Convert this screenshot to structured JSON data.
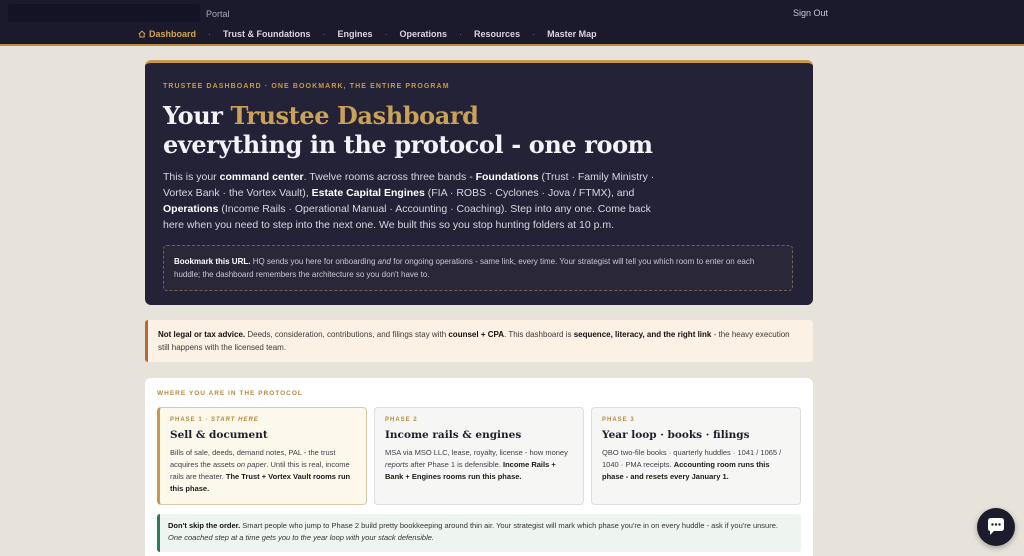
{
  "header": {
    "portal_label": "Portal",
    "sign_out": "Sign Out",
    "nav": [
      {
        "label": "Dashboard",
        "active": true
      },
      {
        "label": "Trust & Foundations"
      },
      {
        "label": "Engines"
      },
      {
        "label": "Operations"
      },
      {
        "label": "Resources"
      },
      {
        "label": "Master Map"
      }
    ],
    "separator": "·"
  },
  "hero": {
    "eyebrow": "TRUSTEE DASHBOARD · ONE BOOKMARK, THE ENTIRE PROGRAM",
    "title_pre": "Your ",
    "title_gold": "Trustee Dashboard",
    "title_line2": "everything in the protocol - one room",
    "lead": [
      "This is your ",
      "command center",
      ". Twelve rooms across three bands - ",
      "Foundations",
      " (Trust · Family Ministry · Vortex Bank · the Vortex Vault), ",
      "Estate Capital Engines",
      " (FIA · ROBS · Cyclones · Jova / FTMX), and ",
      "Operations",
      " (Income Rails · Operational Manual · Accounting · Coaching). Step into any one. Come back here when you need to step into the next one. We built this so you stop hunting folders at 10 p.m."
    ],
    "bookmark_strong": "Bookmark this URL.",
    "bookmark_text_1": " HQ sends you here for onboarding ",
    "bookmark_em": "and",
    "bookmark_text_2": " for ongoing operations - same link, every time. Your strategist will tell you which room to enter on each huddle; the dashboard remembers the architecture so you don't have to."
  },
  "disclaimer": {
    "strong": "Not legal or tax advice.",
    "text_1": " Deeds, consideration, contributions, and filings stay with ",
    "strong_2": "counsel + CPA",
    "text_2": ". This dashboard is ",
    "strong_3": "sequence, literacy, and the right link",
    "text_3": " - the heavy execution still happens with the licensed team."
  },
  "protocol": {
    "section_title": "WHERE YOU ARE IN THE PROTOCOL",
    "phases": [
      {
        "label": "PHASE 1 · ",
        "label_em": "START HERE",
        "title": "Sell & document",
        "desc_1": "Bills of sale, deeds, demand notes, PAL - the trust acquires the assets ",
        "desc_em": "on paper",
        "desc_2": ". Until this is real, income rails are theater. ",
        "desc_strong": "The Trust + Vortex Vault rooms run this phase."
      },
      {
        "label": "PHASE 2",
        "title": "Income rails & engines",
        "desc_1": "MSA via MSO LLC, lease, royalty, license - how money ",
        "desc_em": "reports",
        "desc_2": " after Phase 1 is defensible. ",
        "desc_strong": "Income Rails + Bank + Engines rooms run this phase."
      },
      {
        "label": "PHASE 3",
        "title": "Year loop · books · filings",
        "desc_1": "QBO two-file books · quarterly huddles · 1041 / 1065 / 1040 · PMA receipts. ",
        "desc_strong": "Accounting room runs this phase - and resets every January 1."
      }
    ],
    "warning_strong": "Don't skip the order.",
    "warning_text": " Smart people who jump to Phase 2 build pretty bookkeeping around thin air. Your strategist will mark which phase you're in on every huddle - ask if you're unsure. ",
    "warning_em": "One coached step at a time gets you to the year loop with your stack defensible."
  },
  "colors": {
    "accent_gold": "#c99a45",
    "header_bg": "#1b1a2c",
    "hero_bg": "#242236",
    "disclaimer_border": "#b36a34",
    "warning_border": "#2d7a5a"
  },
  "icons": {
    "home": "home-icon",
    "chat": "chat-bubble-icon"
  }
}
